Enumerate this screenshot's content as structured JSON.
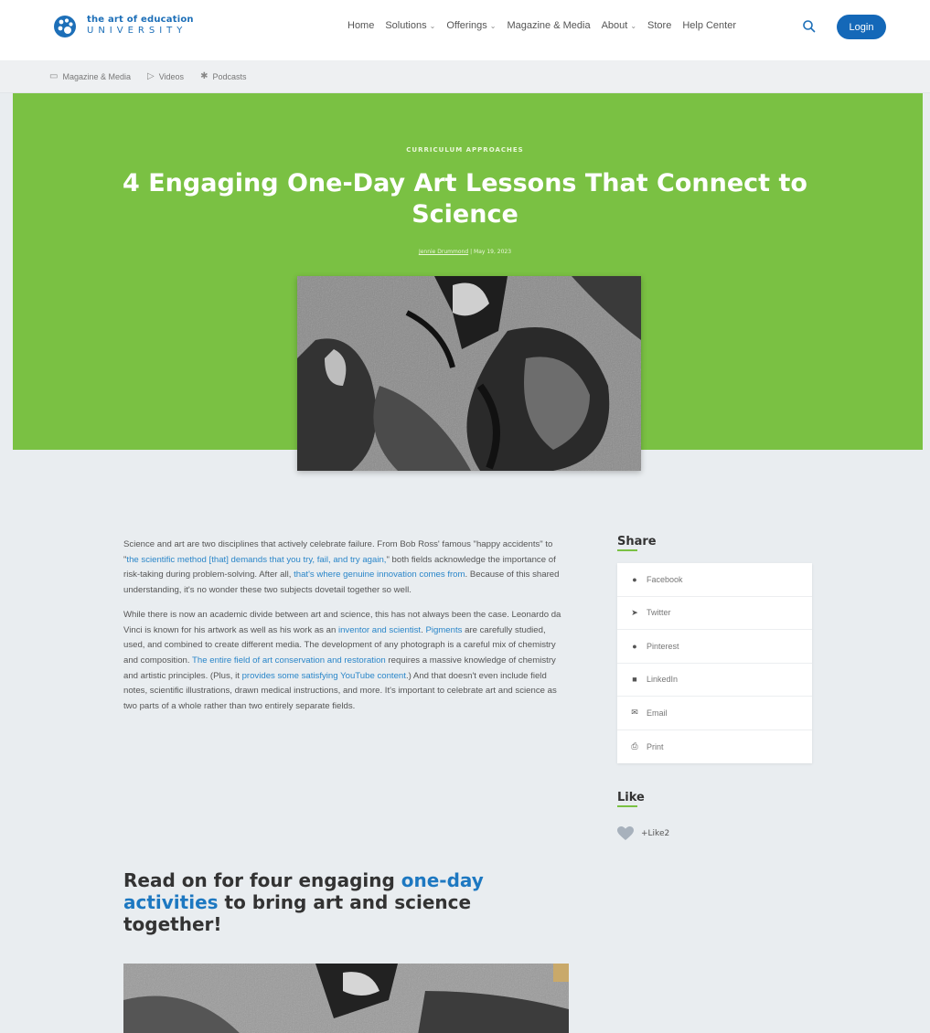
{
  "brand": {
    "line1": "the art of education",
    "line2": "UNIVERSITY",
    "blue": "#1d6fb8"
  },
  "nav": {
    "items": [
      {
        "label": "Home",
        "dropdown": false
      },
      {
        "label": "Solutions",
        "dropdown": true
      },
      {
        "label": "Offerings",
        "dropdown": true
      },
      {
        "label": "Magazine & Media",
        "dropdown": false
      },
      {
        "label": "About",
        "dropdown": true
      },
      {
        "label": "Store",
        "dropdown": false
      },
      {
        "label": "Help Center",
        "dropdown": false
      }
    ],
    "login_label": "Login",
    "search_icon": "search-icon"
  },
  "subnav": {
    "items": [
      {
        "icon": "magazine-icon",
        "label": "Magazine & Media"
      },
      {
        "icon": "play-icon",
        "label": "Videos"
      },
      {
        "icon": "podcast-icon",
        "label": "Podcasts"
      }
    ]
  },
  "hero": {
    "eyebrow": "CURRICULUM APPROACHES",
    "title": "4 Engaging One-Day Art Lessons That Connect to Science",
    "author": "Jennie Drummond",
    "date": "May 19, 2023",
    "bg_color": "#7ac143"
  },
  "article": {
    "p1": [
      {
        "t": "Science and art are two disciplines that actively celebrate failure. From Bob Ross' famous \"happy accidents\" to \""
      },
      {
        "t": "the scientific method [that] demands that you try, fail, and try again,",
        "link": true
      },
      {
        "t": "\" both fields acknowledge the importance of risk-taking during problem-solving. After all, "
      },
      {
        "t": "that's where genuine innovation comes from",
        "link": true
      },
      {
        "t": ". Because of this shared understanding, it's no wonder these two subjects dovetail together so well."
      }
    ],
    "p2": [
      {
        "t": "While there is now an academic divide between art and science, this has not always been the case. Leonardo da Vinci is known for his artwork as well as his work as an "
      },
      {
        "t": "inventor and scientist",
        "link": true
      },
      {
        "t": ". "
      },
      {
        "t": "Pigments",
        "link": true
      },
      {
        "t": " are carefully studied, used, and combined to create different media. The development of any photograph is a careful mix of chemistry and composition. "
      },
      {
        "t": "The entire field of art conservation and restoration",
        "link": true
      },
      {
        "t": " requires a massive knowledge of chemistry and artistic principles. (Plus, it "
      },
      {
        "t": "provides some satisfying YouTube content",
        "link": true
      },
      {
        "t": ".) And that doesn't even include field notes, scientific illustrations, drawn medical instructions, and more. It's important to celebrate art and science as two parts of a whole rather than two entirely separate fields."
      }
    ],
    "subhead_pre": "Read on for four engaging ",
    "subhead_link": "one-day activities",
    "subhead_post": " to bring art and science together!"
  },
  "sidebar": {
    "share_title": "Share",
    "share_items": [
      {
        "icon": "facebook-icon",
        "glyph": "●",
        "label": "Facebook"
      },
      {
        "icon": "twitter-icon",
        "glyph": "➤",
        "label": "Twitter"
      },
      {
        "icon": "pinterest-icon",
        "glyph": "●",
        "label": "Pinterest"
      },
      {
        "icon": "linkedin-icon",
        "glyph": "■",
        "label": "LinkedIn"
      },
      {
        "icon": "email-icon",
        "glyph": "✉",
        "label": "Email"
      },
      {
        "icon": "print-icon",
        "glyph": "⎙",
        "label": "Print"
      }
    ],
    "like_title": "Like",
    "like_label": "+Like2"
  }
}
